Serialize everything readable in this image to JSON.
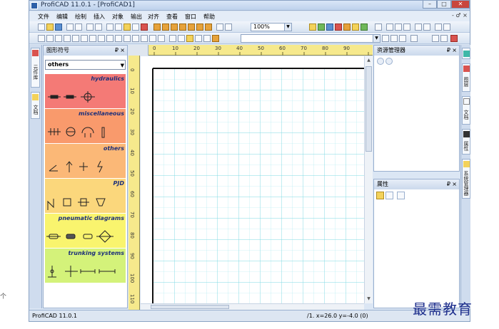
{
  "window": {
    "title": "ProfiCAD 11.0.1 - [ProfiCAD1]"
  },
  "menu": {
    "items": [
      "文件",
      "编辑",
      "绘制",
      "插入",
      "对象",
      "输出",
      "对齐",
      "查看",
      "窗口",
      "帮助"
    ],
    "mdi_controls": "- ♂ ×"
  },
  "toolbar": {
    "zoom": "100%",
    "font_value": ""
  },
  "left_tabs": [
    "元件库",
    "文档"
  ],
  "symbols_panel": {
    "title": "图形符号",
    "pin": "₽",
    "close": "×",
    "category_select": "others",
    "categories": [
      {
        "name": "hydraulics",
        "color": "#f47a76"
      },
      {
        "name": "miscellaneous",
        "color": "#f99a6c"
      },
      {
        "name": "others",
        "color": "#fbb877"
      },
      {
        "name": "PJD",
        "color": "#fbd77c"
      },
      {
        "name": "pneumatic diagrams",
        "color": "#f9f46e"
      },
      {
        "name": "trunking systems",
        "color": "#d4f27a"
      }
    ]
  },
  "ruler": {
    "h_labels": [
      "0",
      "10",
      "20",
      "30",
      "40",
      "50",
      "60",
      "70",
      "80",
      "90"
    ],
    "v_labels": [
      "0",
      "10",
      "20",
      "30",
      "40",
      "50",
      "60",
      "70",
      "80",
      "90",
      "100",
      "110"
    ]
  },
  "resource_panel": {
    "title": "资源管理器",
    "pin": "₽",
    "close": "×"
  },
  "properties_panel": {
    "title": "属性",
    "pin": "₽",
    "close": "×"
  },
  "right_tabs": [
    "图层",
    "文档",
    "属性",
    "系统管理器"
  ],
  "status": {
    "app": "ProfiCAD 11.0.1",
    "coords": "/1.  x=26.0  y=-4.0 (0)"
  },
  "watermark": "最需教育",
  "edge_char": "个"
}
